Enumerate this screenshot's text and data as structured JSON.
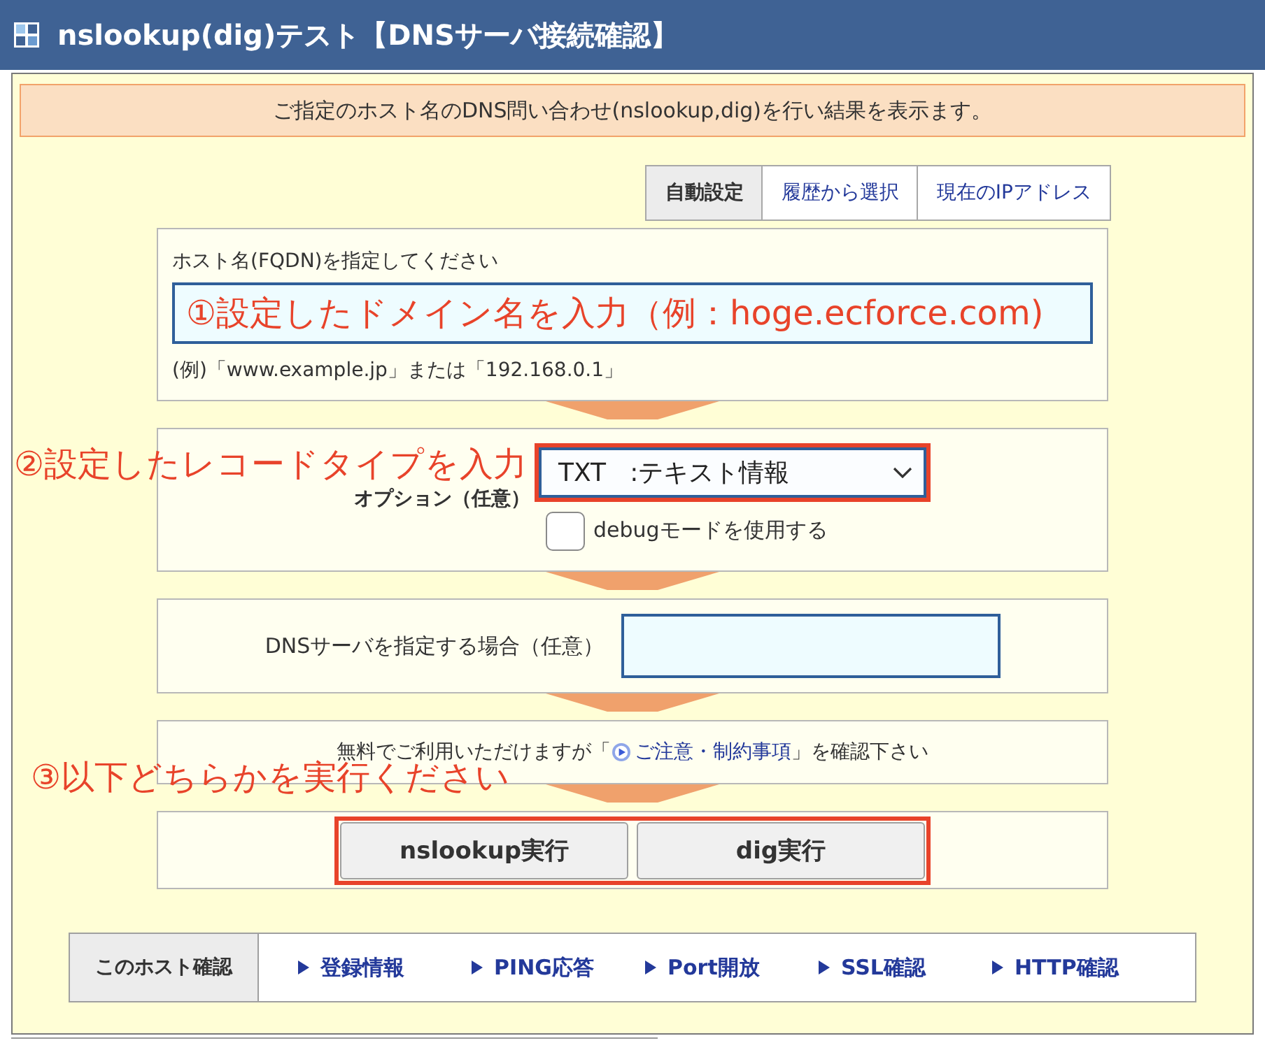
{
  "window": {
    "title": "nslookup(dig)テスト【DNSサーバ接続確認】"
  },
  "intro": "ご指定のホスト名のDNS問い合わせ(nslookup,dig)を行い結果を表示ます。",
  "tabs": [
    {
      "label": "自動設定",
      "selected": true
    },
    {
      "label": "履歴から選択",
      "selected": false
    },
    {
      "label": "現在のIPアドレス",
      "selected": false
    }
  ],
  "host_section": {
    "label": "ホスト名(FQDN)を指定してください",
    "annotation": "①設定したドメイン名を入力（例：hoge.ecforce.com)",
    "example": "(例)「www.example.jp」または「192.168.0.1」"
  },
  "option_section": {
    "annotation": "②設定したレコードタイプを入力",
    "label": "オプション（任意）",
    "record_type": "TXT   :テキスト情報",
    "highlighted": true,
    "debug": {
      "label": "debugモードを使用する",
      "checked": false
    }
  },
  "dns_section": {
    "label": "DNSサーバを指定する場合（任意）"
  },
  "notice": {
    "text_before": "無料でご利用いただけますが「",
    "link": "ご注意・制約事項",
    "text_after": "」を確認下さい"
  },
  "execute_section": {
    "annotation": "③以下どちらかを実行ください",
    "highlighted": true,
    "buttons": [
      "nslookup実行",
      "dig実行"
    ]
  },
  "host_check": {
    "label": "このホスト確認",
    "links": [
      "登録情報",
      "PING応答",
      "Port開放",
      "SSL確認",
      "HTTP確認"
    ]
  }
}
